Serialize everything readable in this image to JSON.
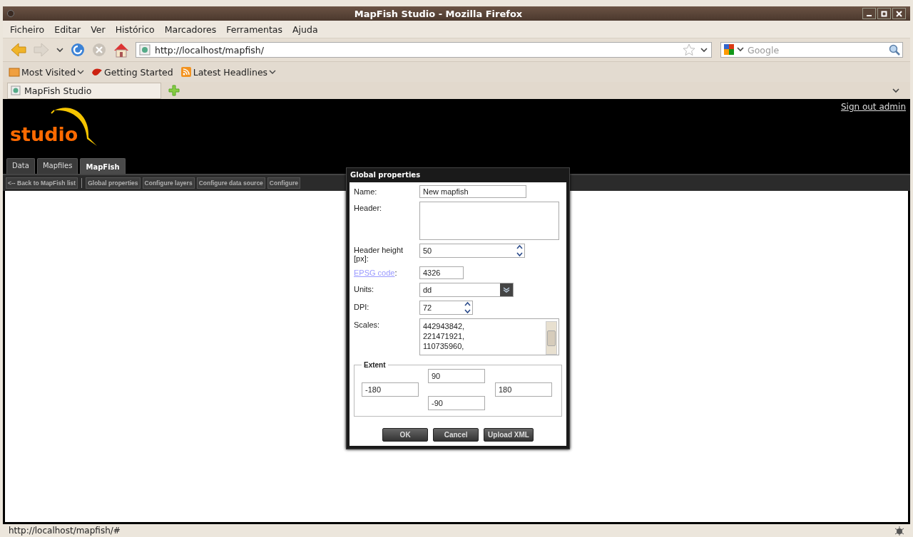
{
  "window": {
    "title": "MapFish Studio - Mozilla Firefox"
  },
  "menu": [
    "Ficheiro",
    "Editar",
    "Ver",
    "Histórico",
    "Marcadores",
    "Ferramentas",
    "Ajuda"
  ],
  "address": {
    "value": "http://localhost/mapfish/"
  },
  "search": {
    "placeholder": "Google"
  },
  "bookmarks": [
    {
      "label": "Most Visited",
      "kind": "folder"
    },
    {
      "label": "Getting Started",
      "kind": "page"
    },
    {
      "label": "Latest Headlines",
      "kind": "feed"
    }
  ],
  "browser_tabs": [
    {
      "label": "MapFish Studio",
      "selected": true
    }
  ],
  "app": {
    "logo": "studio",
    "sign_out": "Sign out admin",
    "tabs": [
      {
        "label": "Data",
        "selected": false
      },
      {
        "label": "Mapfiles",
        "selected": false
      },
      {
        "label": "MapFish",
        "selected": true
      }
    ],
    "toolbar": [
      {
        "label": "<-- Back to MapFish list",
        "disabled": true
      },
      {
        "label": "Global properties",
        "disabled": true
      },
      {
        "label": "Configure layers",
        "disabled": true
      },
      {
        "label": "Configure data source",
        "disabled": true
      },
      {
        "label": "Configure",
        "disabled": true
      }
    ]
  },
  "dialog": {
    "title": "Global properties",
    "fields": [
      {
        "label": "Name:",
        "kind": "text",
        "value": "New mapfish"
      },
      {
        "label": "Header:",
        "kind": "area"
      },
      {
        "label": "Header height [px]:",
        "kind": "spinner",
        "value": "50"
      },
      {
        "label": "EPSG code",
        "suffix": ":",
        "kind": "link",
        "value": "4326"
      },
      {
        "label": "Units:",
        "kind": "combo",
        "value": "dd"
      },
      {
        "label": "DPI:",
        "kind": "spinner-small",
        "value": "72"
      },
      {
        "label": "Scales:",
        "kind": "list",
        "lines": [
          "442943842,",
          "221471921,",
          "110735960,"
        ]
      }
    ],
    "extent": {
      "legend": "Extent",
      "north": "90",
      "west": "-180",
      "east": "180",
      "south": "-90"
    },
    "buttons": [
      "OK",
      "Cancel",
      "Upload XML"
    ]
  },
  "status_bar": {
    "text": "http://localhost/mapfish/#"
  }
}
